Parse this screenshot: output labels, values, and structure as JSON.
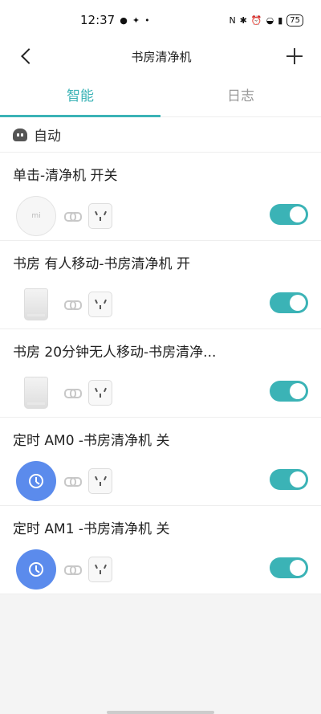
{
  "status_bar": {
    "time": "12:37",
    "battery": "75"
  },
  "header": {
    "title": "书房清净机"
  },
  "tabs": [
    {
      "label": "智能",
      "active": true
    },
    {
      "label": "日志",
      "active": false
    }
  ],
  "section": {
    "label": "自动"
  },
  "rules": [
    {
      "title": "单击-清净机 开关",
      "trigger_device": "button",
      "enabled": true
    },
    {
      "title": "书房 有人移动-书房清净机 开",
      "trigger_device": "motion-sensor",
      "enabled": true
    },
    {
      "title": "书房 20分钟无人移动-书房清净...",
      "trigger_device": "motion-sensor",
      "enabled": true
    },
    {
      "title": "定时 AM0 -书房清净机 关",
      "trigger_device": "timer",
      "enabled": true
    },
    {
      "title": "定时 AM1 -书房清净机 关",
      "trigger_device": "timer",
      "enabled": true
    }
  ],
  "colors": {
    "accent": "#3bb3b6",
    "timer_blue": "#5b8bec"
  }
}
